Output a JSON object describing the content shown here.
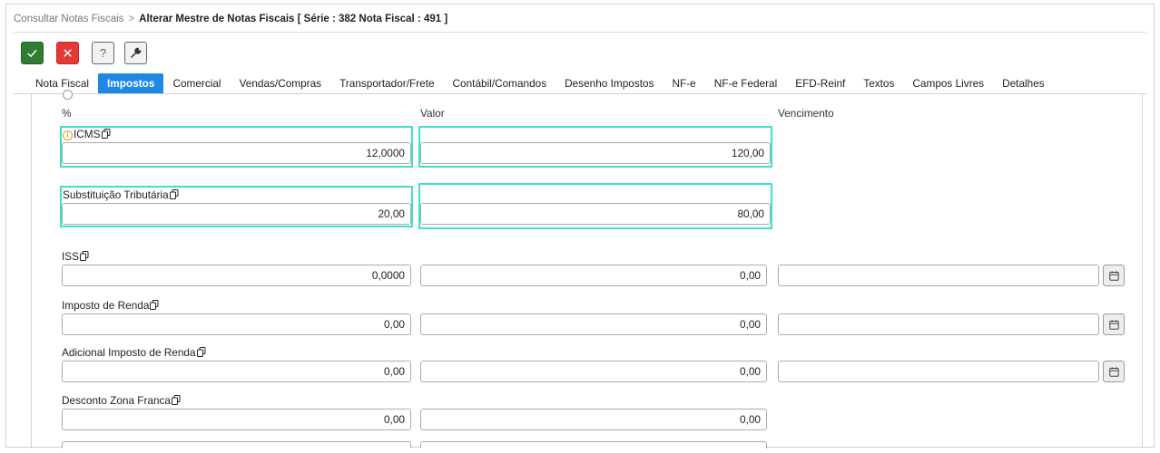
{
  "breadcrumb": {
    "parent": "Consultar Notas Fiscais",
    "separator": ">",
    "current": "Alterar Mestre de Notas Fiscais [ Série : 382 Nota Fiscal : 491 ]"
  },
  "toolbar": {
    "confirm_icon": "check-icon",
    "cancel_icon": "close-icon",
    "help_label": "?",
    "tools_icon": "wrench-icon",
    "confirm_color": "#2e7d32",
    "cancel_color": "#e53935"
  },
  "tabs": [
    {
      "label": "Nota Fiscal"
    },
    {
      "label": "Impostos",
      "active": true
    },
    {
      "label": "Comercial"
    },
    {
      "label": "Vendas/Compras"
    },
    {
      "label": "Transportador/Frete"
    },
    {
      "label": "Contábil/Comandos"
    },
    {
      "label": "Desenho Impostos"
    },
    {
      "label": "NF-e"
    },
    {
      "label": "NF-e Federal"
    },
    {
      "label": "EFD-Reinf"
    },
    {
      "label": "Textos"
    },
    {
      "label": "Campos Livres"
    },
    {
      "label": "Detalhes"
    }
  ],
  "columns": {
    "percent": "%",
    "value": "Valor",
    "due": "Vencimento"
  },
  "taxes": {
    "icms": {
      "label": "ICMS",
      "percent": "12,0000",
      "value": "120,00"
    },
    "st": {
      "label": "Substituição Tributária",
      "percent": "20,00",
      "value": "80,00"
    },
    "iss": {
      "label": "ISS",
      "percent": "0,0000",
      "value": "0,00",
      "due": ""
    },
    "ir": {
      "label": "Imposto de Renda",
      "percent": "0,00",
      "value": "0,00",
      "due": ""
    },
    "air": {
      "label": "Adicional Imposto de Renda",
      "percent": "0,00",
      "value": "0,00",
      "due": ""
    },
    "dzf": {
      "label": "Desconto Zona Franca",
      "percent": "0,00",
      "value": "0,00"
    }
  },
  "colors": {
    "active_tab": "#1e88e5",
    "highlight": "#3fe0c8",
    "warning_icon": "#e0a020"
  }
}
